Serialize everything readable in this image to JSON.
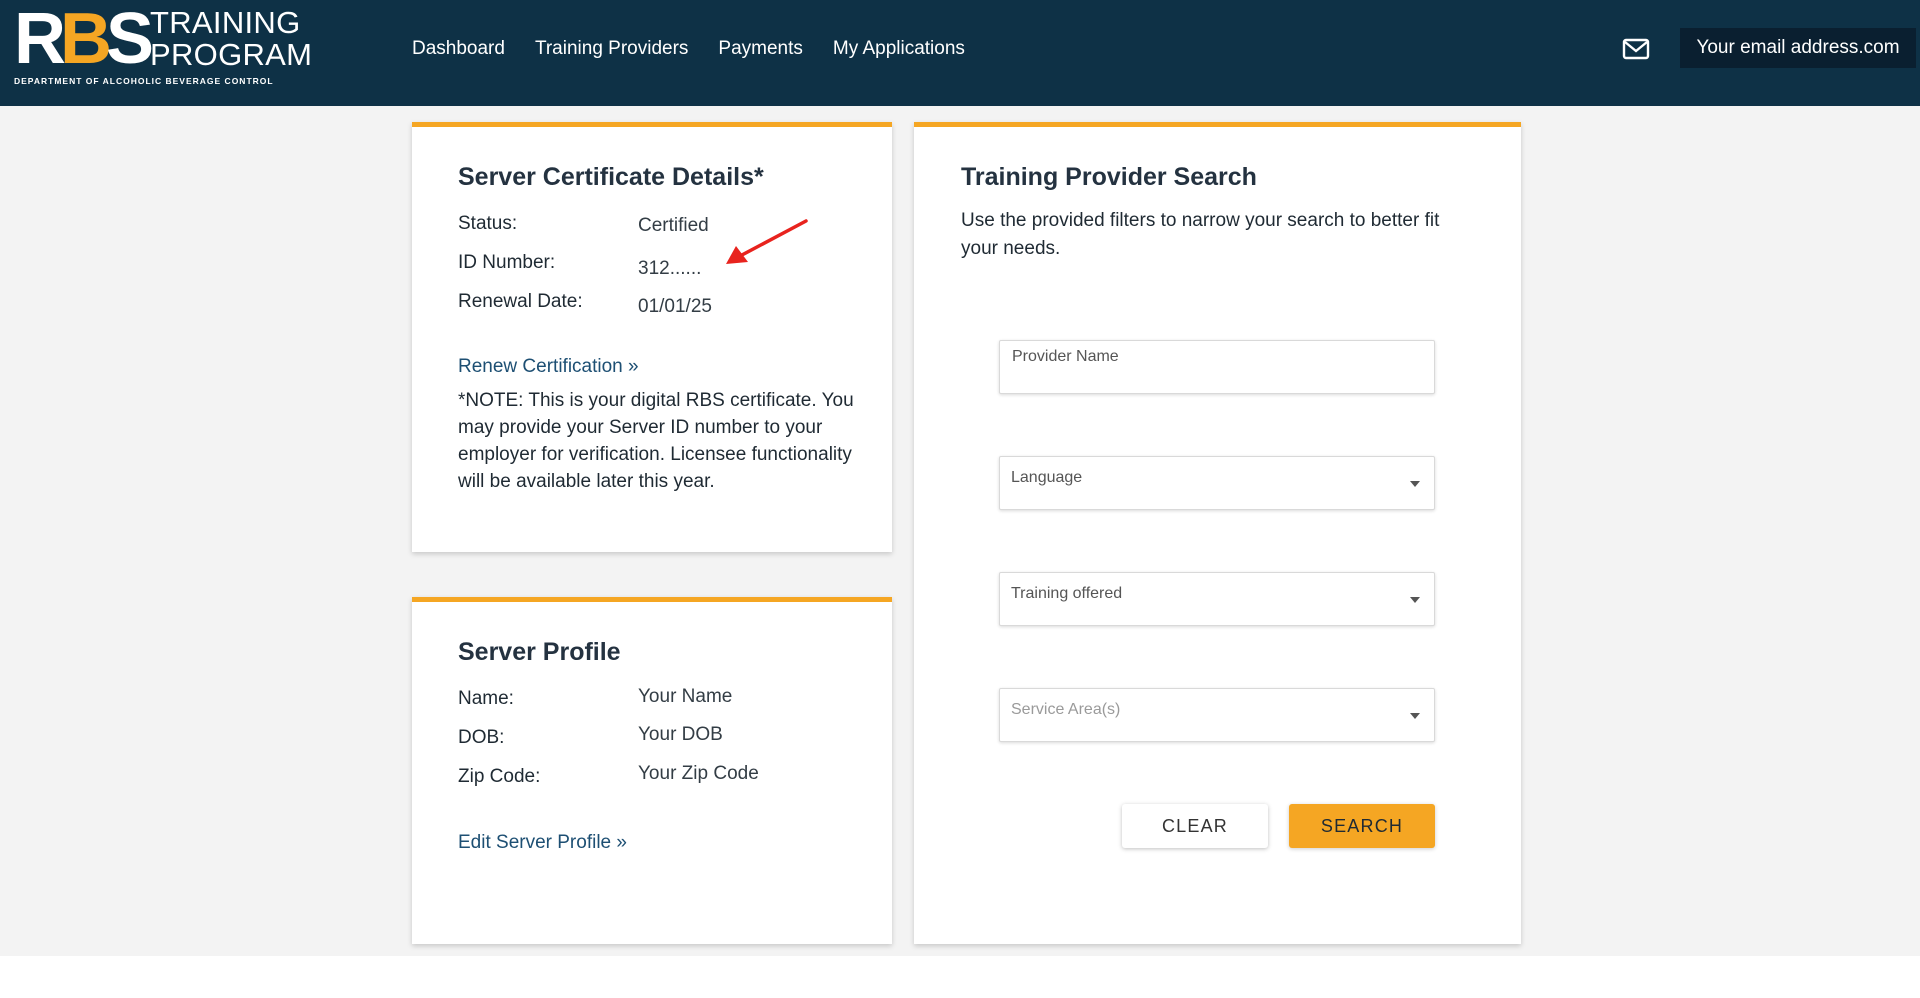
{
  "header": {
    "logo": {
      "mark_r": "R",
      "mark_b": "B",
      "mark_s": "S",
      "line1": "TRAINING",
      "line2": "PROGRAM",
      "subtitle": "DEPARTMENT OF ALCOHOLIC BEVERAGE CONTROL"
    },
    "nav": [
      {
        "label": "Dashboard"
      },
      {
        "label": "Training Providers"
      },
      {
        "label": "Payments"
      },
      {
        "label": "My Applications"
      }
    ],
    "email": "Your email address.com",
    "mail_icon": "mail-icon"
  },
  "certificate": {
    "title": "Server Certificate Details*",
    "status_label": "Status:",
    "status_value": "Certified",
    "id_label": "ID Number:",
    "id_value": "312......",
    "renewal_label": "Renewal Date:",
    "renewal_value": "01/01/25",
    "renew_link": "Renew Certification »",
    "note": "*NOTE: This is your digital RBS certificate. You may provide your Server ID number to your employer for verification. Licensee functionality will be available later this year."
  },
  "profile": {
    "title": "Server Profile",
    "name_label": "Name:",
    "name_value": "Your Name",
    "dob_label": "DOB:",
    "dob_value": "Your DOB",
    "zip_label": "Zip Code:",
    "zip_value": "Your Zip Code",
    "edit_link": "Edit Server Profile »"
  },
  "search": {
    "title": "Training Provider Search",
    "description": "Use the provided filters to narrow your search to better fit your needs.",
    "provider_placeholder": "Provider Name",
    "language_label": "Language",
    "training_label": "Training offered",
    "service_label": "Service Area(s)",
    "clear_label": "CLEAR",
    "search_label": "SEARCH"
  },
  "colors": {
    "header_bg": "#0e3146",
    "accent": "#f5a623",
    "annotation_arrow": "#e8231e"
  }
}
